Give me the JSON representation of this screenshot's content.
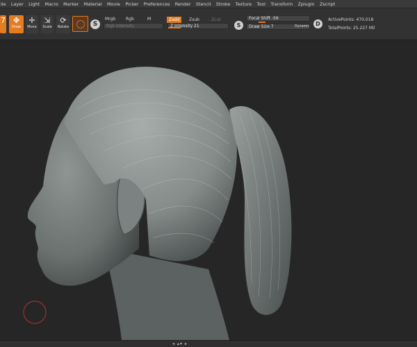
{
  "menu": [
    "ile",
    "Layer",
    "Light",
    "Macro",
    "Marker",
    "Material",
    "Movie",
    "Picker",
    "Preferences",
    "Render",
    "Stencil",
    "Stroke",
    "Texture",
    "Tool",
    "Transform",
    "Zplugin",
    "Zscript"
  ],
  "toolbar": {
    "edit_label": "",
    "draw_label": "Draw",
    "move_label": "Move",
    "scale_label": "Scale",
    "rotate_label": "Rotate",
    "mrgb": "Mrgb",
    "rgb": "Rgb",
    "m": "M",
    "rgb_intensity": "Rgb Intensity",
    "zadd": "Zadd",
    "zsub": "Zsub",
    "zcut": "Zcut",
    "z_intensity": "Z Intensity 21",
    "focal_shift": "Focal Shift -56",
    "draw_size": "Draw Size 7",
    "dynamic": "Dynamic",
    "active_points": "ActivePoints: 470,018",
    "total_points": "TotalPoints: 25.227 Mil"
  },
  "bottom": {
    "controls": "◂ ▴▾ ▸"
  },
  "colors": {
    "accent": "#e47c21",
    "menubar": "#3a3a3a",
    "toolbar": "#323232",
    "canvas": "#262626"
  }
}
